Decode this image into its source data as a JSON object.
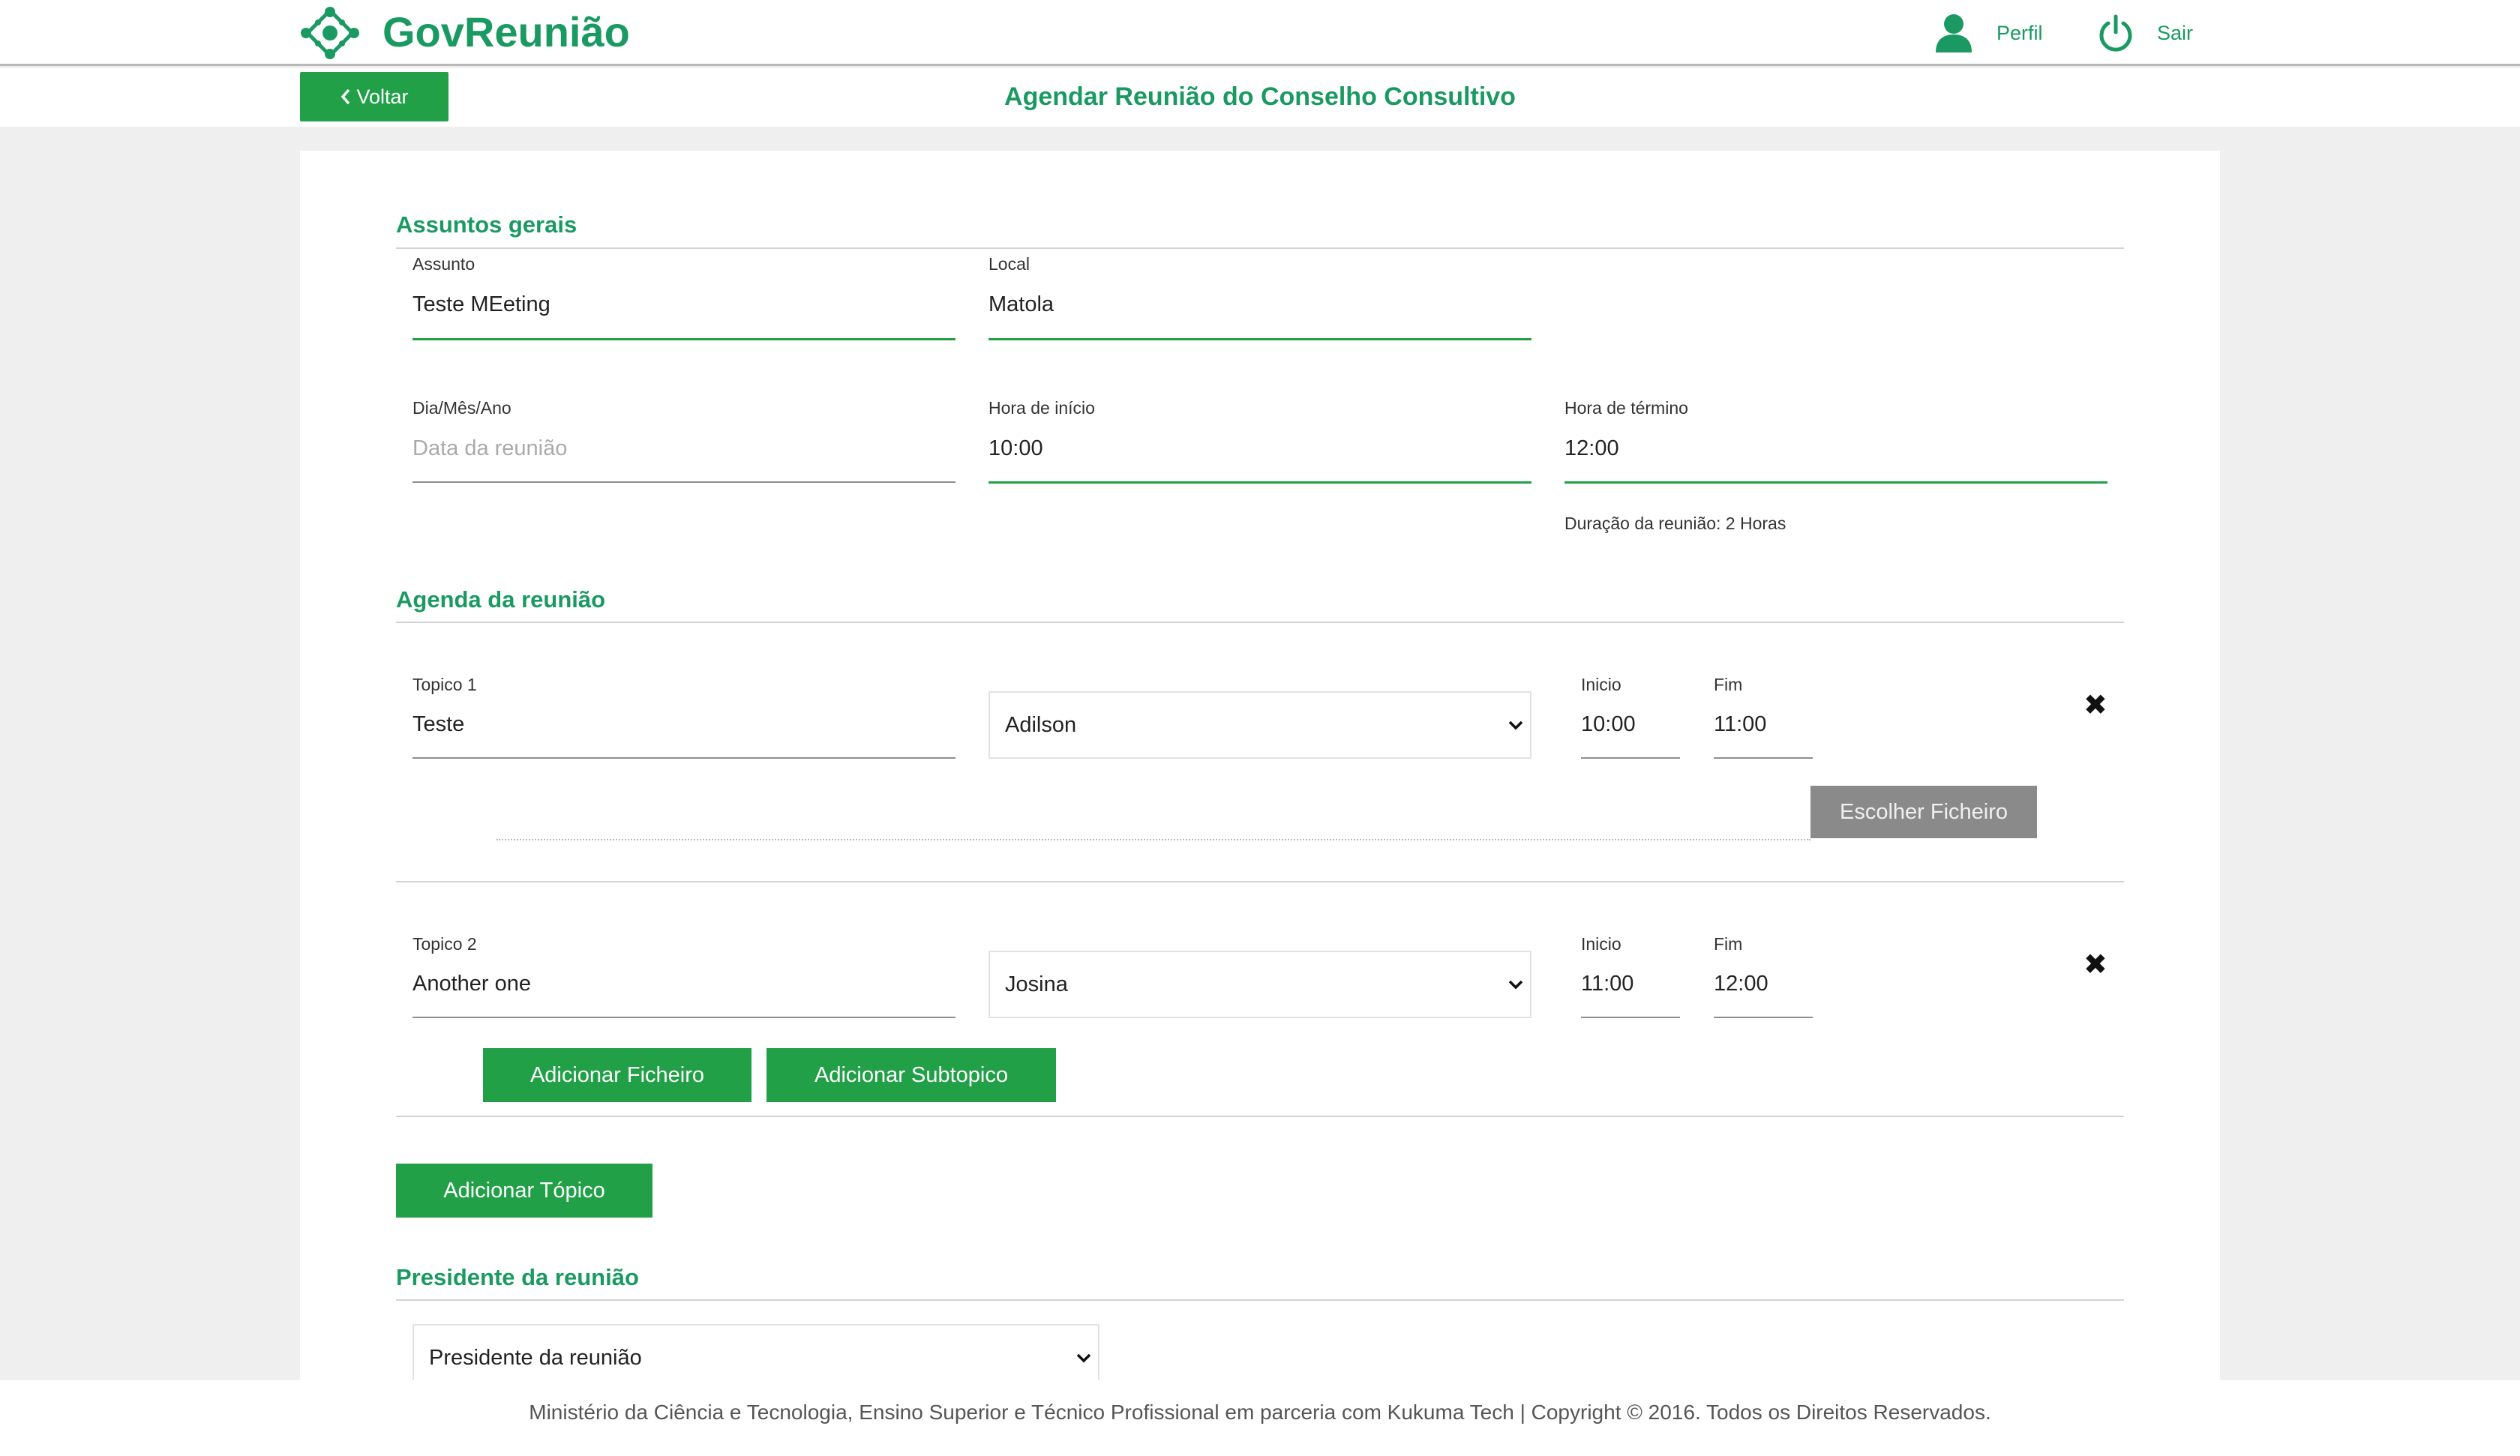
{
  "header": {
    "app_name": "GovReunião",
    "profile_label": "Perfil",
    "logout_label": "Sair",
    "back_label": "Voltar",
    "page_title": "Agendar Reunião do Conselho Consultivo",
    "brand_color": "#1a9a62",
    "button_color": "#21a047"
  },
  "general": {
    "section_title": "Assuntos gerais",
    "subject": {
      "label": "Assunto",
      "value": "Teste MEeting"
    },
    "location": {
      "label": "Local",
      "value": "Matola"
    },
    "date": {
      "label": "Dia/Mês/Ano",
      "placeholder": "Data da reunião",
      "value": ""
    },
    "start_time": {
      "label": "Hora de início",
      "value": "10:00"
    },
    "end_time": {
      "label": "Hora de término",
      "value": "12:00"
    },
    "duration_text": "Duração da reunião: 2 Horas"
  },
  "agenda": {
    "section_title": "Agenda da reunião",
    "topics": [
      {
        "label": "Topico 1",
        "value": "Teste",
        "person": "Adilson",
        "start_label": "Inicio",
        "start": "10:00",
        "end_label": "Fim",
        "end": "11:00"
      },
      {
        "label": "Topico 2",
        "value": "Another one",
        "person": "Josina",
        "start_label": "Inicio",
        "start": "11:00",
        "end_label": "Fim",
        "end": "12:00"
      }
    ],
    "choose_file_label": "Escolher Ficheiro",
    "add_file_label": "Adicionar Ficheiro",
    "add_subtopic_label": "Adicionar Subtopico",
    "add_topic_label": "Adicionar Tópico",
    "remove_glyph": "✖"
  },
  "president": {
    "section_title": "Presidente da reunião",
    "selected": "Presidente da reunião"
  },
  "footer": {
    "text": "Ministério da Ciência e Tecnologia, Ensino Superior e Técnico Profissional em parceria com Kukuma Tech | Copyright © 2016. Todos os Direitos Reservados."
  },
  "icons": {
    "logo": "diamond-logo-icon",
    "profile": "user-icon",
    "logout": "power-icon",
    "back": "chevron-left-icon",
    "dropdown": "chevron-down-icon",
    "remove": "close-icon"
  }
}
